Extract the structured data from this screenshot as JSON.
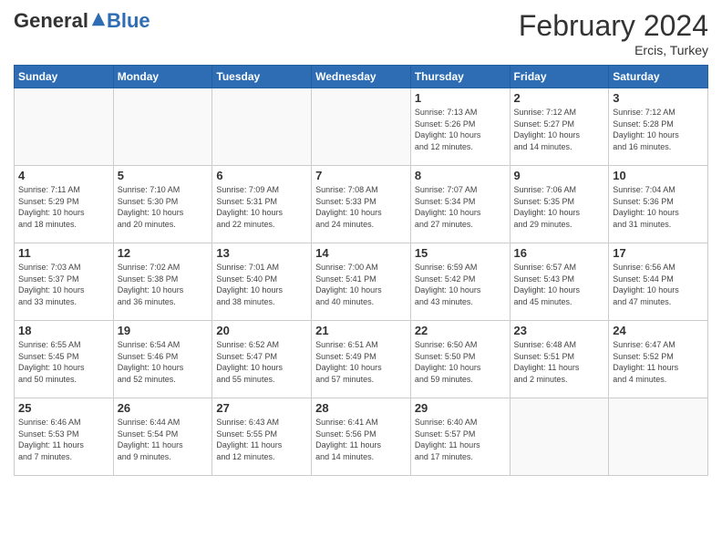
{
  "header": {
    "logo_general": "General",
    "logo_blue": "Blue",
    "month_title": "February 2024",
    "location": "Ercis, Turkey"
  },
  "days_of_week": [
    "Sunday",
    "Monday",
    "Tuesday",
    "Wednesday",
    "Thursday",
    "Friday",
    "Saturday"
  ],
  "weeks": [
    [
      {
        "day": "",
        "info": ""
      },
      {
        "day": "",
        "info": ""
      },
      {
        "day": "",
        "info": ""
      },
      {
        "day": "",
        "info": ""
      },
      {
        "day": "1",
        "info": "Sunrise: 7:13 AM\nSunset: 5:26 PM\nDaylight: 10 hours\nand 12 minutes."
      },
      {
        "day": "2",
        "info": "Sunrise: 7:12 AM\nSunset: 5:27 PM\nDaylight: 10 hours\nand 14 minutes."
      },
      {
        "day": "3",
        "info": "Sunrise: 7:12 AM\nSunset: 5:28 PM\nDaylight: 10 hours\nand 16 minutes."
      }
    ],
    [
      {
        "day": "4",
        "info": "Sunrise: 7:11 AM\nSunset: 5:29 PM\nDaylight: 10 hours\nand 18 minutes."
      },
      {
        "day": "5",
        "info": "Sunrise: 7:10 AM\nSunset: 5:30 PM\nDaylight: 10 hours\nand 20 minutes."
      },
      {
        "day": "6",
        "info": "Sunrise: 7:09 AM\nSunset: 5:31 PM\nDaylight: 10 hours\nand 22 minutes."
      },
      {
        "day": "7",
        "info": "Sunrise: 7:08 AM\nSunset: 5:33 PM\nDaylight: 10 hours\nand 24 minutes."
      },
      {
        "day": "8",
        "info": "Sunrise: 7:07 AM\nSunset: 5:34 PM\nDaylight: 10 hours\nand 27 minutes."
      },
      {
        "day": "9",
        "info": "Sunrise: 7:06 AM\nSunset: 5:35 PM\nDaylight: 10 hours\nand 29 minutes."
      },
      {
        "day": "10",
        "info": "Sunrise: 7:04 AM\nSunset: 5:36 PM\nDaylight: 10 hours\nand 31 minutes."
      }
    ],
    [
      {
        "day": "11",
        "info": "Sunrise: 7:03 AM\nSunset: 5:37 PM\nDaylight: 10 hours\nand 33 minutes."
      },
      {
        "day": "12",
        "info": "Sunrise: 7:02 AM\nSunset: 5:38 PM\nDaylight: 10 hours\nand 36 minutes."
      },
      {
        "day": "13",
        "info": "Sunrise: 7:01 AM\nSunset: 5:40 PM\nDaylight: 10 hours\nand 38 minutes."
      },
      {
        "day": "14",
        "info": "Sunrise: 7:00 AM\nSunset: 5:41 PM\nDaylight: 10 hours\nand 40 minutes."
      },
      {
        "day": "15",
        "info": "Sunrise: 6:59 AM\nSunset: 5:42 PM\nDaylight: 10 hours\nand 43 minutes."
      },
      {
        "day": "16",
        "info": "Sunrise: 6:57 AM\nSunset: 5:43 PM\nDaylight: 10 hours\nand 45 minutes."
      },
      {
        "day": "17",
        "info": "Sunrise: 6:56 AM\nSunset: 5:44 PM\nDaylight: 10 hours\nand 47 minutes."
      }
    ],
    [
      {
        "day": "18",
        "info": "Sunrise: 6:55 AM\nSunset: 5:45 PM\nDaylight: 10 hours\nand 50 minutes."
      },
      {
        "day": "19",
        "info": "Sunrise: 6:54 AM\nSunset: 5:46 PM\nDaylight: 10 hours\nand 52 minutes."
      },
      {
        "day": "20",
        "info": "Sunrise: 6:52 AM\nSunset: 5:47 PM\nDaylight: 10 hours\nand 55 minutes."
      },
      {
        "day": "21",
        "info": "Sunrise: 6:51 AM\nSunset: 5:49 PM\nDaylight: 10 hours\nand 57 minutes."
      },
      {
        "day": "22",
        "info": "Sunrise: 6:50 AM\nSunset: 5:50 PM\nDaylight: 10 hours\nand 59 minutes."
      },
      {
        "day": "23",
        "info": "Sunrise: 6:48 AM\nSunset: 5:51 PM\nDaylight: 11 hours\nand 2 minutes."
      },
      {
        "day": "24",
        "info": "Sunrise: 6:47 AM\nSunset: 5:52 PM\nDaylight: 11 hours\nand 4 minutes."
      }
    ],
    [
      {
        "day": "25",
        "info": "Sunrise: 6:46 AM\nSunset: 5:53 PM\nDaylight: 11 hours\nand 7 minutes."
      },
      {
        "day": "26",
        "info": "Sunrise: 6:44 AM\nSunset: 5:54 PM\nDaylight: 11 hours\nand 9 minutes."
      },
      {
        "day": "27",
        "info": "Sunrise: 6:43 AM\nSunset: 5:55 PM\nDaylight: 11 hours\nand 12 minutes."
      },
      {
        "day": "28",
        "info": "Sunrise: 6:41 AM\nSunset: 5:56 PM\nDaylight: 11 hours\nand 14 minutes."
      },
      {
        "day": "29",
        "info": "Sunrise: 6:40 AM\nSunset: 5:57 PM\nDaylight: 11 hours\nand 17 minutes."
      },
      {
        "day": "",
        "info": ""
      },
      {
        "day": "",
        "info": ""
      }
    ]
  ]
}
